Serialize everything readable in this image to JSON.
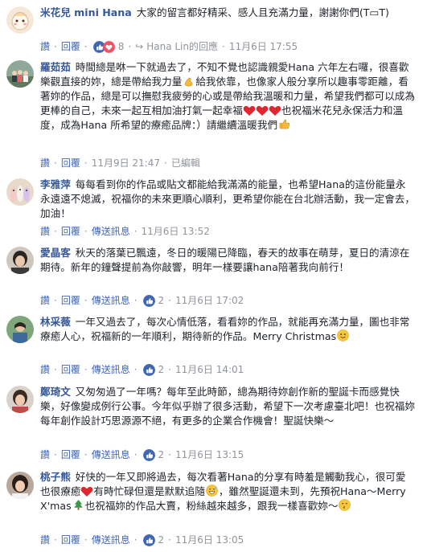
{
  "comments": [
    {
      "author": "米花兒 mini Hana",
      "text": "大家的留言都好精采、感人且充滿力量，謝謝你們(T▭T)",
      "actions": {
        "like": "讚",
        "reply": "回覆"
      },
      "reaction_count": "8",
      "replied_by": "Hana Lin的回應",
      "time": "11月6日 17:55"
    },
    {
      "author": "羅茹茹",
      "text_a": "時間總是咻一下就過去了，不知不覺也認識親愛Hana 六年左右囉，很喜歡樂觀直接的妳，總是帶給我力量",
      "text_b": "給我依靠，也像家人般分享所以趣事零距離，看著妳的作品，總是可以撫慰我疲勞的心或是帶給我溫暖和力量，希望我們都可以成為更棒的自己，未來一起互相加油打氣一起幸福",
      "text_c": "也祝福米花兒永保活力和溫度，成為Hana 所希望的療癒品牌：）請繼續溫暖我們",
      "actions": {
        "like": "讚",
        "reply": "回覆"
      },
      "time": "11月9日 21:47",
      "edited": "已編輯"
    },
    {
      "author": "李雅萍",
      "text": "每每看到你的作品或貼文都能給我滿滿的能量，也希望Hana的這份能量永永遠遠不熄滅，祝福你的未來更順心順利，更希望你能在台北辦活動，我一定會去，加油！",
      "actions": {
        "like": "讚",
        "reply": "回覆",
        "message": "傳送訊息"
      },
      "time": "11月6日 13:52"
    },
    {
      "author": "愛晶客",
      "text": "秋天的落葉已飄遠，冬日的暖陽已降臨，春天的故事在萌芽，夏日的清涼在期待。新年的鐘聲提前為你敲響，明年一樣要讓hana陪著我向前行！",
      "actions": {
        "like": "讚",
        "reply": "回覆",
        "message": "傳送訊息"
      },
      "reaction_count": "2",
      "time": "11月6日 17:02"
    },
    {
      "author": "林采薇",
      "text": "一年又過去了，每次心情低落，看看妳的作品，就能再充滿力量，圖也非常療癒人心，祝福新的一年順利，期待新的作品。Merry Christmas",
      "actions": {
        "like": "讚",
        "reply": "回覆",
        "message": "傳送訊息"
      },
      "reaction_count": "2",
      "time": "11月6日 14:01"
    },
    {
      "author": "鄭琦文",
      "text": "又匆匆過了一年嗎？每年至此時節，總為期待妳創作新的聖誕卡而感覺快樂，好像變成例行公事。今年似乎辦了很多活動，希望下一次考慮臺北吧！也祝福妳每年創作設計巧思源源不絕，有更多的企業合作機會！聖誕快樂～",
      "actions": {
        "like": "讚",
        "reply": "回覆",
        "message": "傳送訊息"
      },
      "reaction_count": "2",
      "time": "11月6日 13:15"
    },
    {
      "author": "桃子熊",
      "text_a": "好快的一年又即將過去，每次看著Hana的分享有時羞是觸動我心，很可愛也很療癒",
      "text_b": "有時忙碌但還是默默追隨",
      "text_c": "，雖然聖誕還未到，先預祝Hana～Merry X'mas",
      "text_d": "也祝福妳的作品大賣，粉絲越來越多，跟我一樣喜歡妳～",
      "actions": {
        "like": "讚",
        "reply": "回覆",
        "message": "傳送訊息"
      },
      "reaction_count": "2",
      "time": "11月6日 13:05"
    }
  ],
  "icons": {
    "like_color": "#4267b2",
    "love_color": "#f25268",
    "link_color": "#365899"
  }
}
